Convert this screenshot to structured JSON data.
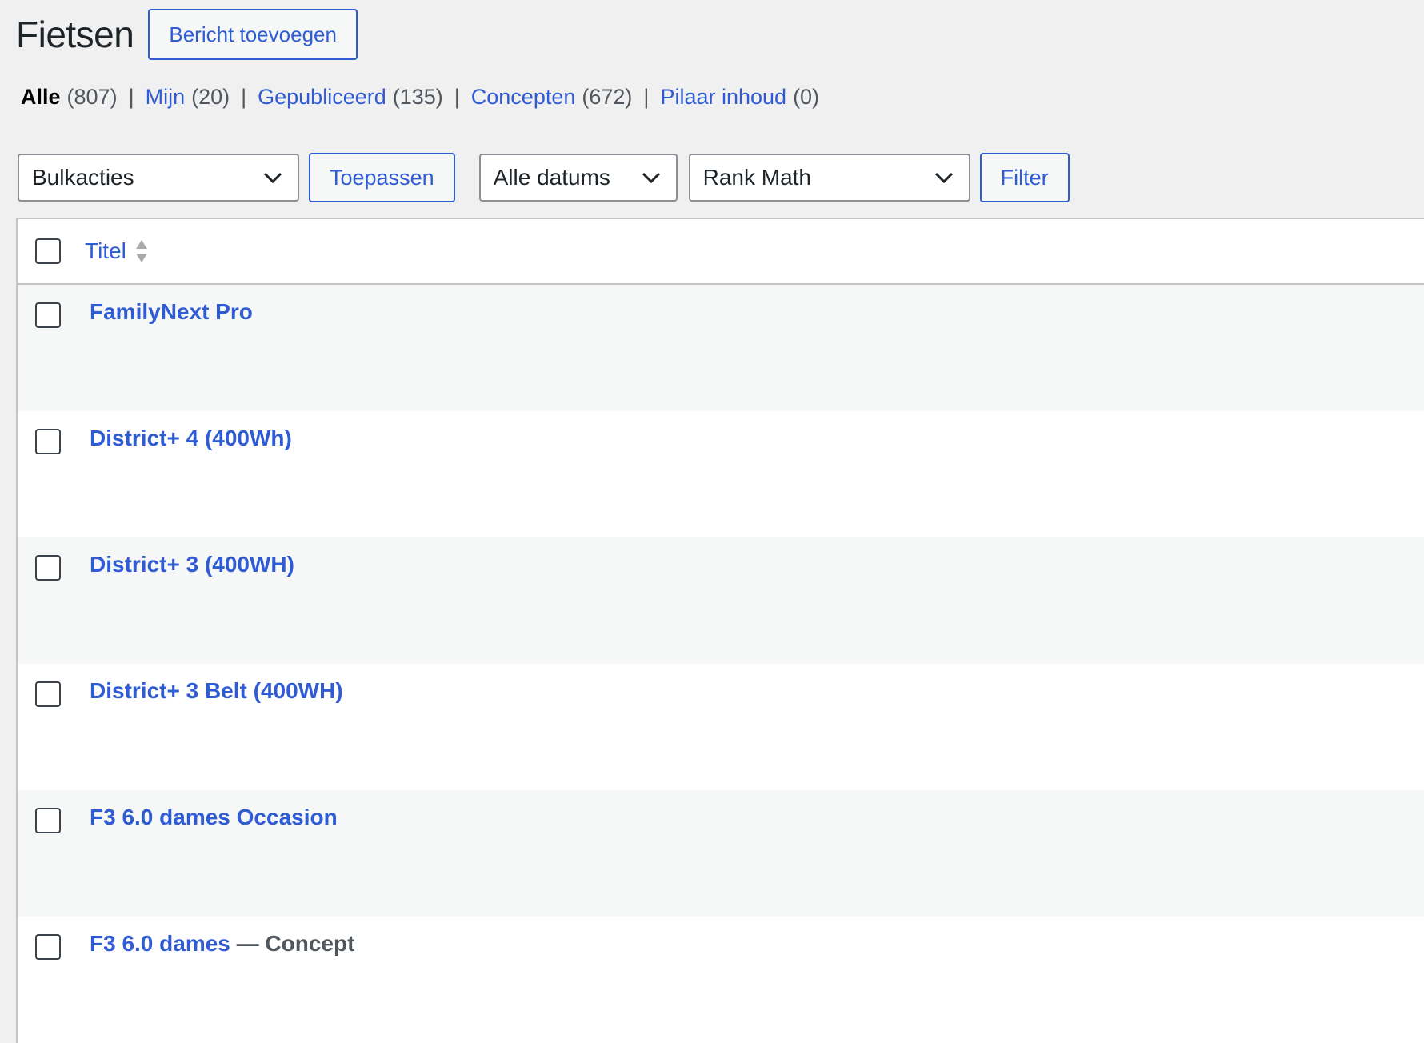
{
  "header": {
    "title": "Fietsen",
    "add_button_label": "Bericht toevoegen"
  },
  "views": [
    {
      "label": "Alle",
      "count": "(807)",
      "current": true
    },
    {
      "label": "Mijn",
      "count": "(20)",
      "current": false
    },
    {
      "label": "Gepubliceerd",
      "count": "(135)",
      "current": false
    },
    {
      "label": "Concepten",
      "count": "(672)",
      "current": false
    },
    {
      "label": "Pilaar inhoud",
      "count": "(0)",
      "current": false
    }
  ],
  "views_separator": "|",
  "tablenav": {
    "bulk_actions": "Bulkacties",
    "apply_label": "Toepassen",
    "dates": "Alle datums",
    "rank_math": "Rank Math",
    "filter_label": "Filter"
  },
  "table": {
    "column_title": "Titel",
    "rows": [
      {
        "title": "FamilyNext Pro",
        "state": ""
      },
      {
        "title": "District+ 4 (400Wh)",
        "state": ""
      },
      {
        "title": "District+ 3 (400WH)",
        "state": ""
      },
      {
        "title": "District+ 3 Belt (400WH)",
        "state": ""
      },
      {
        "title": "F3 6.0 dames Occasion",
        "state": ""
      },
      {
        "title": "F3 6.0 dames",
        "state": " — Concept"
      }
    ]
  },
  "colors": {
    "accent": "#2f5bd3",
    "background": "#f0f0f1",
    "row_alt": "#f6f7f7",
    "text": "#1d2327",
    "muted": "#50575e"
  },
  "icons": {
    "select_arrow": "chevron-down-icon",
    "sort": "sort-arrows-icon"
  }
}
